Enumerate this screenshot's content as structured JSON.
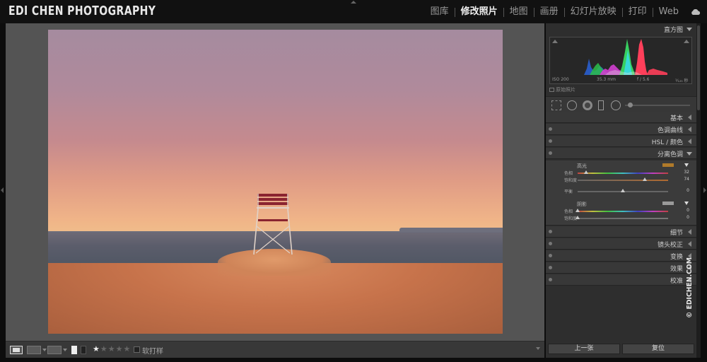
{
  "brand": {
    "logo": "EDI CHEN PHOTOGRAPHY"
  },
  "modules": [
    {
      "label": "图库",
      "active": false
    },
    {
      "label": "修改照片",
      "active": true
    },
    {
      "label": "地图",
      "active": false
    },
    {
      "label": "画册",
      "active": false
    },
    {
      "label": "幻灯片放映",
      "active": false
    },
    {
      "label": "打印",
      "active": false
    },
    {
      "label": "Web",
      "active": false
    }
  ],
  "histogram": {
    "title": "直方图",
    "iso": "ISO 200",
    "focal_length": "35.3 mm",
    "aperture": "f / 5.6",
    "shutter": "¹⁄₁₂₅ 秒",
    "original_photo_label": "原始照片"
  },
  "panels": {
    "basic": "基本",
    "tone_curve": "色调曲线",
    "hsl": "HSL / 颜色",
    "split_toning": "分离色调",
    "detail": "细节",
    "lens_corrections": "镜头校正",
    "transform": "变换",
    "effects": "效果",
    "calibration": "校准"
  },
  "split_toning": {
    "highlights": {
      "label": "高光",
      "swatch_color": "#b07a2a",
      "hue_label": "色相",
      "hue": "32",
      "hue_fraction": 0.09,
      "saturation_label": "饱和度",
      "saturation": "74",
      "saturation_fraction": 0.74
    },
    "balance": {
      "label": "平衡",
      "value": "0",
      "fraction": 0.5
    },
    "shadows": {
      "label": "阴影",
      "swatch_color": "#9a9a9a",
      "hue_label": "色相",
      "hue": "0",
      "hue_fraction": 0.0,
      "saturation_label": "饱和度",
      "saturation": "0",
      "saturation_fraction": 0.0
    }
  },
  "toolbar": {
    "softproof_label": "软打样",
    "rating": 1,
    "rating_max": 5
  },
  "buttons": {
    "previous": "上一张",
    "reset": "复位"
  },
  "watermark": "© EDICHEN.COM"
}
